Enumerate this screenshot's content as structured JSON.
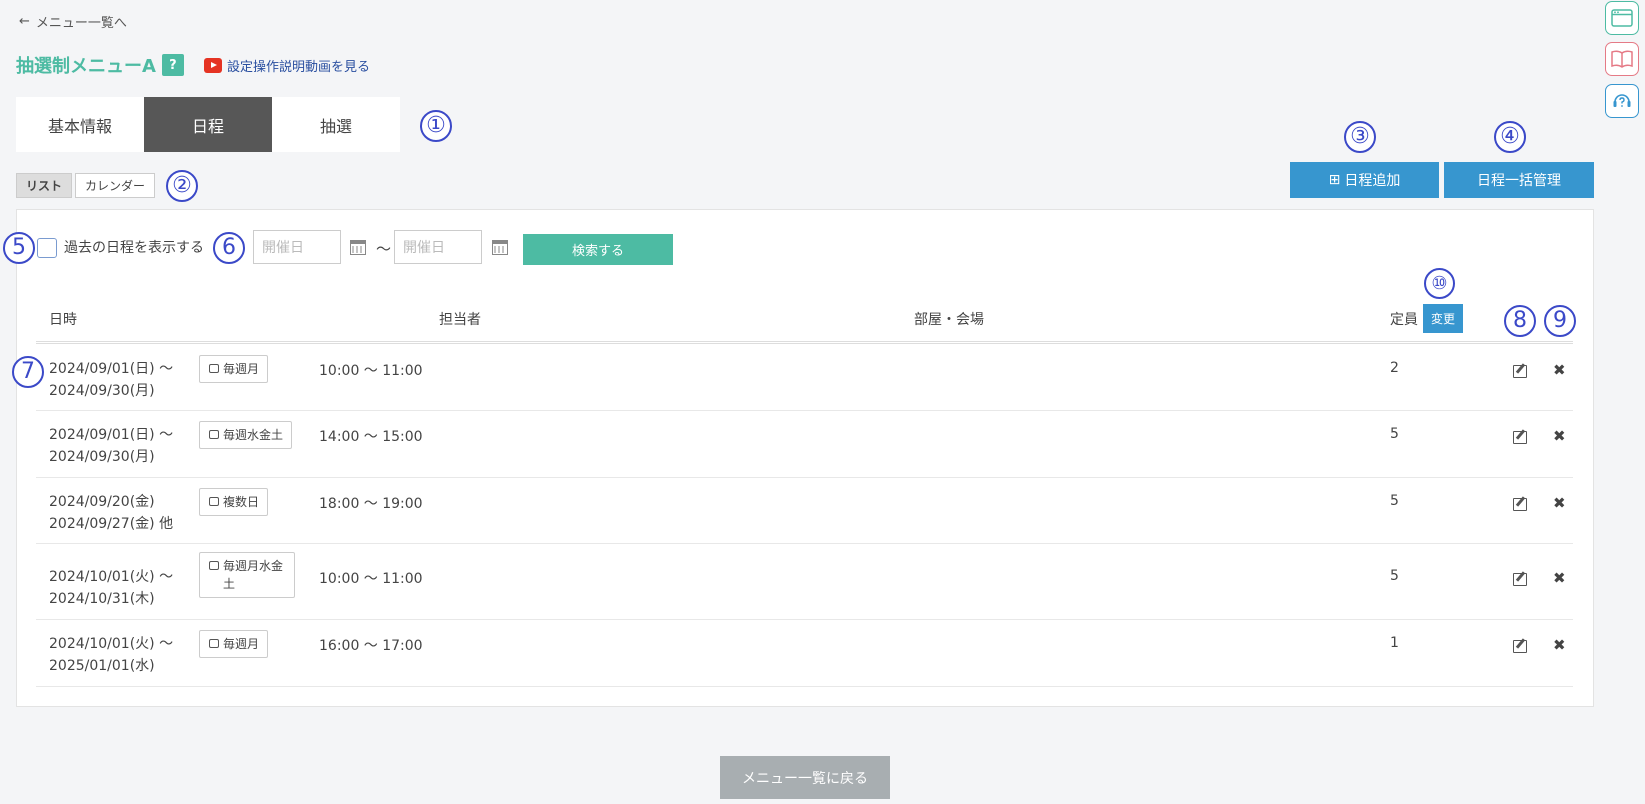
{
  "nav": {
    "back_label": "メニュー一覧へ"
  },
  "header": {
    "title": "抽選制メニューA",
    "help": "?",
    "video_label": "設定操作説明動画を見る"
  },
  "tabs": [
    {
      "label": "基本情報"
    },
    {
      "label": "日程"
    },
    {
      "label": "抽選"
    }
  ],
  "view_toggle": {
    "list": "リスト",
    "calendar": "カレンダー"
  },
  "actions": {
    "add_schedule": "日程追加",
    "bulk_manage": "日程一括管理"
  },
  "filter": {
    "show_past_label": "過去の日程を表示する",
    "date_placeholder": "開催日",
    "tilde": "〜",
    "search_label": "検索する"
  },
  "table": {
    "headers": {
      "datetime": "日時",
      "staff": "担当者",
      "room": "部屋・会場",
      "capacity": "定員",
      "change": "変更"
    },
    "rows": [
      {
        "date1": "2024/09/01(日) 〜",
        "date2": "2024/09/30(月)",
        "recur": "毎週月",
        "time": "10:00 〜 11:00",
        "cap": "2"
      },
      {
        "date1": "2024/09/01(日) 〜",
        "date2": "2024/09/30(月)",
        "recur": "毎週水金土",
        "time": "14:00 〜 15:00",
        "cap": "5"
      },
      {
        "date1": "2024/09/20(金)",
        "date2": "2024/09/27(金)  他",
        "recur": "複数日",
        "time": "18:00 〜 19:00",
        "cap": "5"
      },
      {
        "date1": "2024/10/01(火) 〜",
        "date2": "2024/10/31(木)",
        "recur": "毎週月水金土",
        "time": "10:00 〜 11:00",
        "cap": "5"
      },
      {
        "date1": "2024/10/01(火) 〜",
        "date2": "2025/01/01(水)",
        "recur": "毎週月",
        "time": "16:00 〜 17:00",
        "cap": "1"
      }
    ],
    "delete_glyph": "✖"
  },
  "annotations": {
    "n1": "①",
    "n2": "②",
    "n3": "③",
    "n4": "④",
    "n5": "5",
    "n6": "6",
    "n7": "7",
    "n8": "8",
    "n9": "9",
    "n10": "⑩"
  },
  "footer": {
    "return_label": "メニュー一覧に戻る"
  },
  "colors": {
    "accent_green": "#4dbba3",
    "accent_blue": "#3796cf",
    "annotation": "#3b49c8",
    "active_tab": "#575757"
  },
  "side_icons": [
    "window-icon",
    "book-icon",
    "support-icon"
  ]
}
